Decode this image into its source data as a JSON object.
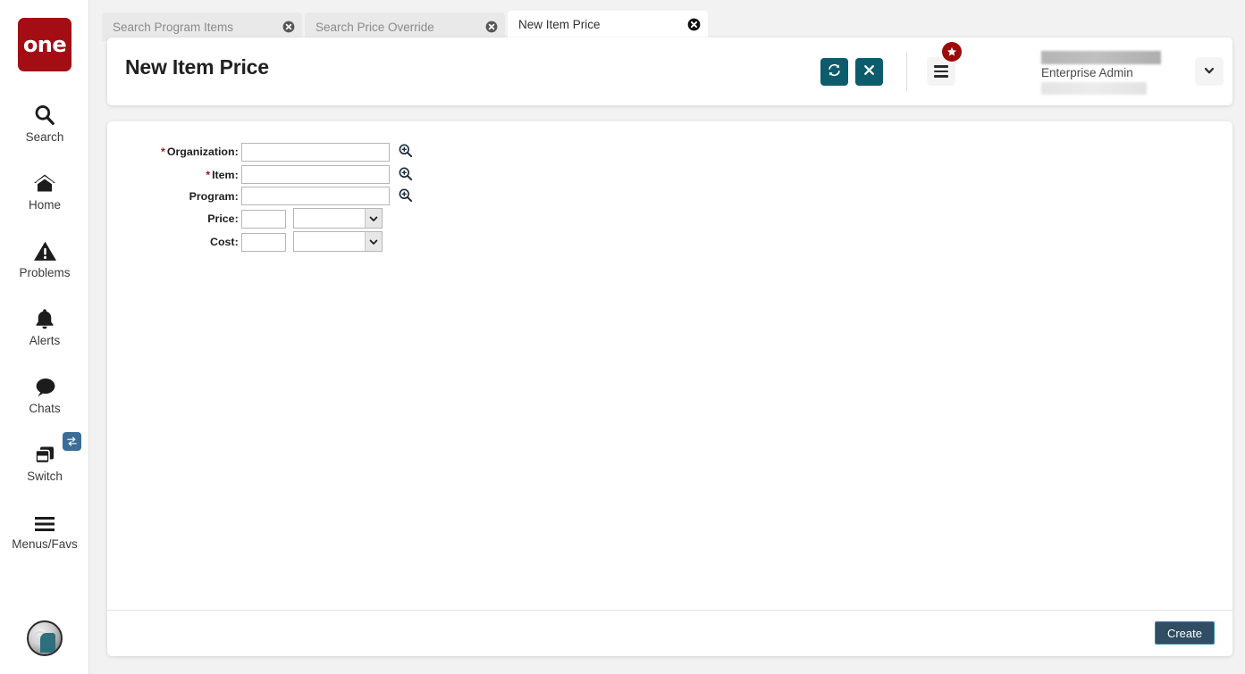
{
  "brand": {
    "logo_text": "one",
    "logo_color": "#a30d13"
  },
  "theme": {
    "accent_teal": "#0d5c6e",
    "badge_red": "#9c0b0b",
    "switch_blue": "#3a6d99",
    "create_btn_bg": "#2f4d63",
    "create_btn_border": "#2a8fa3"
  },
  "sidebar": {
    "items": [
      {
        "label": "Search",
        "icon": "search-icon"
      },
      {
        "label": "Home",
        "icon": "home-icon"
      },
      {
        "label": "Problems",
        "icon": "warning-triangle-icon"
      },
      {
        "label": "Alerts",
        "icon": "bell-icon"
      },
      {
        "label": "Chats",
        "icon": "chat-bubble-icon"
      },
      {
        "label": "Switch",
        "icon": "windows-stack-icon",
        "badge_icon": "swap-arrows-icon"
      },
      {
        "label": "Menus/Favs",
        "icon": "hamburger-icon"
      }
    ],
    "avatar": {
      "name": "user-avatar"
    }
  },
  "tabs": [
    {
      "label": "Search Program Items",
      "active": false,
      "close_icon": "close-circle-icon"
    },
    {
      "label": "Search Price Override",
      "active": false,
      "close_icon": "close-circle-icon"
    },
    {
      "label": "New Item Price",
      "active": true,
      "close_icon": "close-circle-icon"
    }
  ],
  "header": {
    "title": "New Item Price",
    "refresh_icon": "refresh-sync-icon",
    "close_icon": "close-x-icon",
    "menu_icon": "hamburger-menu-icon",
    "favorites_badge_icon": "star-icon",
    "user_role": "Enterprise Admin",
    "dropdown_icon": "chevron-down-icon"
  },
  "form": {
    "fields": [
      {
        "label": "Organization",
        "required": true,
        "type": "lookup",
        "value": "",
        "placeholder": "",
        "lookup_icon": "magnifier-plus-icon"
      },
      {
        "label": "Item",
        "required": true,
        "type": "lookup",
        "value": "",
        "placeholder": "",
        "lookup_icon": "magnifier-plus-icon"
      },
      {
        "label": "Program",
        "required": false,
        "type": "lookup",
        "value": "",
        "placeholder": "",
        "lookup_icon": "magnifier-plus-icon"
      },
      {
        "label": "Price",
        "required": false,
        "type": "amount",
        "value": "",
        "placeholder": "",
        "currency": "",
        "currency_options": [
          ""
        ],
        "dropdown_icon": "chevron-down-icon"
      },
      {
        "label": "Cost",
        "required": false,
        "type": "amount",
        "value": "",
        "placeholder": "",
        "currency": "",
        "currency_options": [
          ""
        ],
        "dropdown_icon": "chevron-down-icon"
      }
    ]
  },
  "footer": {
    "create_label": "Create"
  }
}
